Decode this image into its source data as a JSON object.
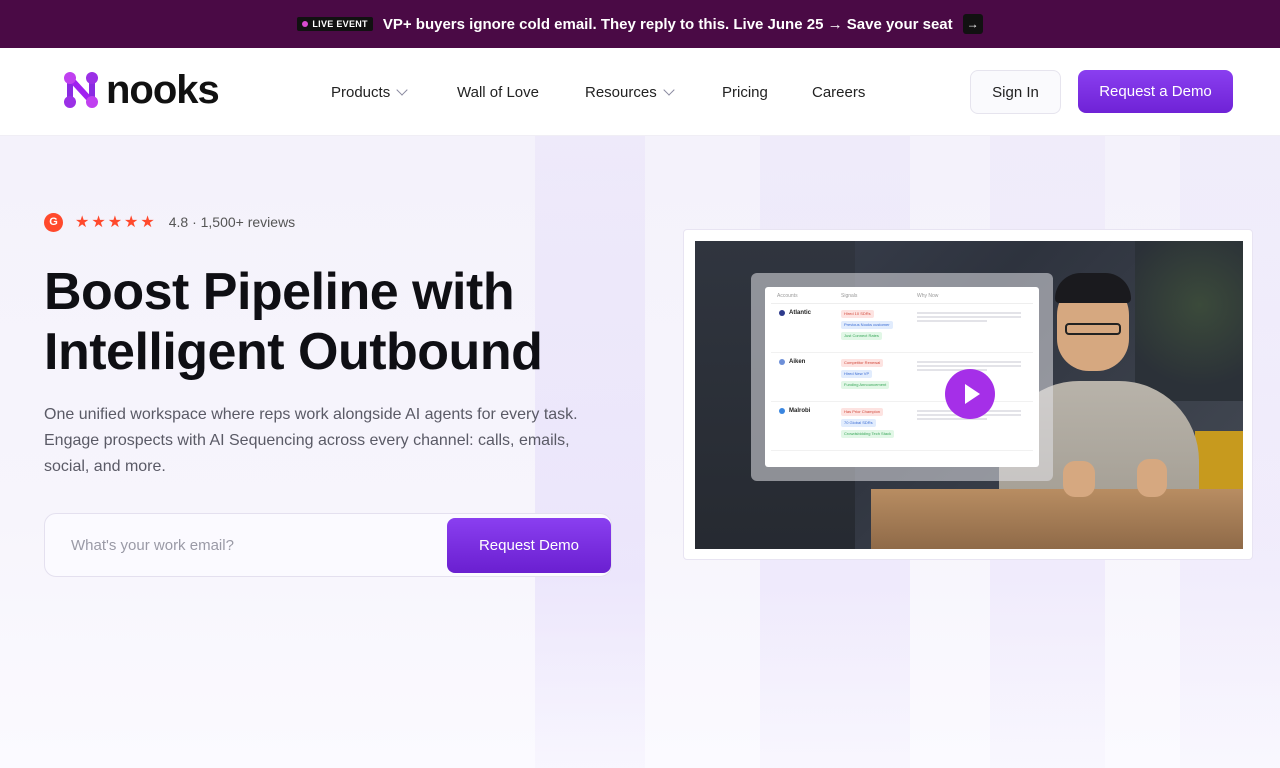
{
  "announcement": {
    "badge": "LIVE EVENT",
    "text": "VP+ buyers ignore cold email. They reply to this. Live June 25 → Save your seat",
    "arrow_icon": "arrow-right-icon"
  },
  "nav": {
    "logo_text": "nooks",
    "links": [
      {
        "label": "Products",
        "dropdown": true
      },
      {
        "label": "Wall of Love",
        "dropdown": false
      },
      {
        "label": "Resources",
        "dropdown": true
      },
      {
        "label": "Pricing",
        "dropdown": false
      },
      {
        "label": "Careers",
        "dropdown": false
      }
    ],
    "sign_in": "Sign In",
    "request_demo": "Request a Demo"
  },
  "hero": {
    "rating": {
      "badge": "G",
      "stars": "★★★★★",
      "score_text": "4.8 · 1,500+ reviews"
    },
    "headline_line1": "Boost Pipeline with",
    "headline_line2": "Intelligent Outbound",
    "subtext": "One unified workspace where reps work alongside AI agents for every task. Engage prospects with AI Sequencing across every channel: calls, emails, social, and more.",
    "email_placeholder": "What's your work email?",
    "cta": "Request Demo"
  },
  "video": {
    "table_headers": [
      "Accounts",
      "Signals",
      "Why Now"
    ],
    "rows": [
      {
        "account": "Atlantic",
        "tags": [
          {
            "text": "Hired 10 SDRs",
            "color": "red"
          },
          {
            "text": "Previous Nooks customer",
            "color": "blue"
          },
          {
            "text": "Just Connect Rates",
            "color": "green"
          }
        ]
      },
      {
        "account": "Aiken",
        "tags": [
          {
            "text": "Competitor Renewal",
            "color": "red"
          },
          {
            "text": "Hired New VP",
            "color": "blue"
          },
          {
            "text": "Funding Announcement",
            "color": "green"
          }
        ]
      },
      {
        "account": "Malrobi",
        "tags": [
          {
            "text": "Has Prior Champion",
            "color": "red"
          },
          {
            "text": "70 Global SDRs",
            "color": "blue"
          },
          {
            "text": "Crowdsbidding Tech Stack",
            "color": "green"
          }
        ]
      }
    ],
    "play_icon": "play-icon"
  },
  "colors": {
    "announcement_bg": "#4a0a45",
    "brand_purple": "#7b2fe6",
    "g2_red": "#ff492c"
  }
}
